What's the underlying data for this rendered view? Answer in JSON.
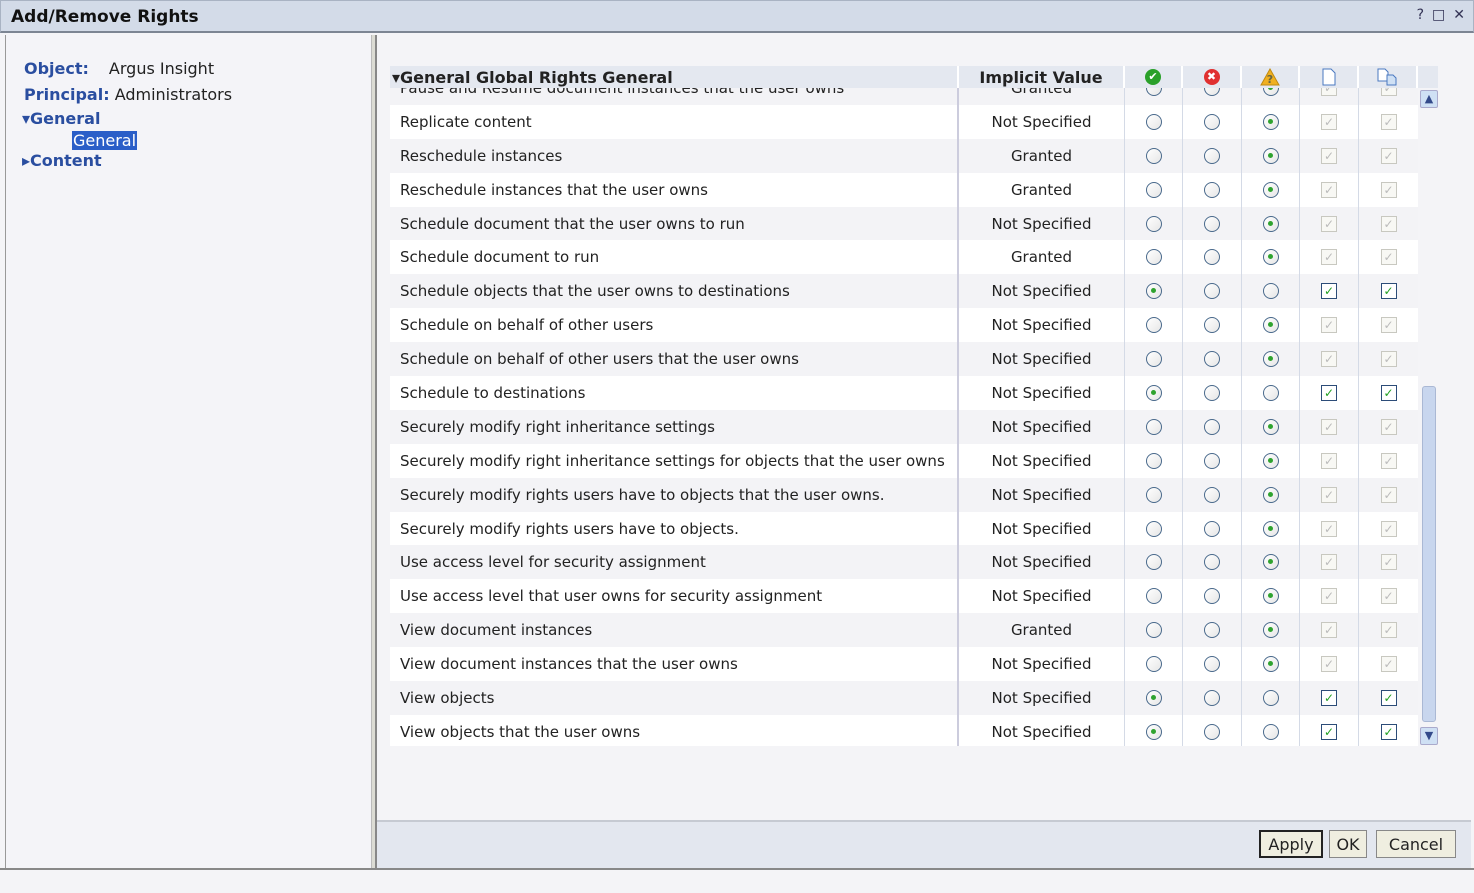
{
  "window": {
    "title": "Add/Remove Rights",
    "help": "?",
    "maximize": "□",
    "close": "✕"
  },
  "info": {
    "object_label": "Object:",
    "object_value": "Argus Insight",
    "principal_label": "Principal:",
    "principal_value": "Administrators"
  },
  "tree": {
    "general": "▾General",
    "general_child": "General",
    "content": "▸Content"
  },
  "table": {
    "title": "▾General Global Rights General",
    "implicit_header": "Implicit Value",
    "icons": [
      "granted-icon",
      "denied-icon",
      "not-specified-icon",
      "apply-to-object-icon",
      "apply-to-subobjects-icon"
    ],
    "rows": [
      {
        "name": "Pause and Resume document instances that the user owns",
        "implicit": "Granted",
        "state": "not_specified"
      },
      {
        "name": "Replicate content",
        "implicit": "Not Specified",
        "state": "not_specified"
      },
      {
        "name": "Reschedule instances",
        "implicit": "Granted",
        "state": "not_specified"
      },
      {
        "name": "Reschedule instances that the user owns",
        "implicit": "Granted",
        "state": "not_specified"
      },
      {
        "name": "Schedule document that the user owns to run",
        "implicit": "Not Specified",
        "state": "not_specified"
      },
      {
        "name": "Schedule document to run",
        "implicit": "Granted",
        "state": "not_specified"
      },
      {
        "name": "Schedule objects that the user owns to destinations",
        "implicit": "Not Specified",
        "state": "granted"
      },
      {
        "name": "Schedule on behalf of other users",
        "implicit": "Not Specified",
        "state": "not_specified"
      },
      {
        "name": "Schedule on behalf of other users that the user owns",
        "implicit": "Not Specified",
        "state": "not_specified"
      },
      {
        "name": "Schedule to destinations",
        "implicit": "Not Specified",
        "state": "granted"
      },
      {
        "name": "Securely modify right inheritance settings",
        "implicit": "Not Specified",
        "state": "not_specified"
      },
      {
        "name": "Securely modify right inheritance settings for objects that the user owns",
        "implicit": "Not Specified",
        "state": "not_specified"
      },
      {
        "name": "Securely modify rights users have to objects that the user owns.",
        "implicit": "Not Specified",
        "state": "not_specified"
      },
      {
        "name": "Securely modify rights users have to objects.",
        "implicit": "Not Specified",
        "state": "not_specified"
      },
      {
        "name": "Use access level for security assignment",
        "implicit": "Not Specified",
        "state": "not_specified"
      },
      {
        "name": "Use access level that user owns for security assignment",
        "implicit": "Not Specified",
        "state": "not_specified"
      },
      {
        "name": "View document instances",
        "implicit": "Granted",
        "state": "not_specified"
      },
      {
        "name": "View document instances that the user owns",
        "implicit": "Not Specified",
        "state": "not_specified"
      },
      {
        "name": "View objects",
        "implicit": "Not Specified",
        "state": "granted"
      },
      {
        "name": "View objects that the user owns",
        "implicit": "Not Specified",
        "state": "granted"
      }
    ]
  },
  "buttons": {
    "apply": "Apply",
    "ok": "OK",
    "cancel": "Cancel"
  },
  "colors": {
    "accent": "#2a4ea0",
    "granted": "#2aa02a",
    "denied": "#e03030",
    "warning": "#f0b020"
  }
}
